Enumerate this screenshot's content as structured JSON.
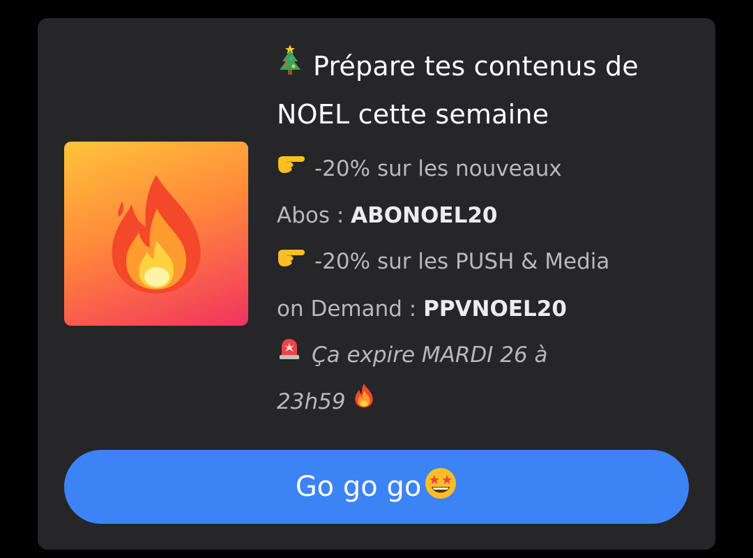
{
  "promo": {
    "title_icon": "christmas-tree-icon",
    "title": "Prépare tes contenus de NOEL cette semaine",
    "line1_icon": "pointing-hand-icon",
    "line1_text": "-20% sur les nouveaux",
    "line2_text": "Abos : ",
    "code1": "ABONOEL20",
    "line3_icon": "pointing-hand-icon",
    "line3_text": "-20% sur les PUSH & Media",
    "line4_text": "on Demand : ",
    "code2": "PPVNOEL20",
    "line5_icon": "siren-icon",
    "line5_text": "Ça expire MARDI 26 à",
    "line6_text": "23h59",
    "line6_icon": "fire-icon",
    "thumbnail_icon": "fire-icon",
    "cta_label": "Go go go",
    "cta_icon": "star-struck-icon",
    "colors": {
      "page_bg": "#000000",
      "card_bg": "#262628",
      "cta_bg": "#3c83f6",
      "gradient_top": "#ffc43a",
      "gradient_bottom": "#f1335f"
    }
  }
}
